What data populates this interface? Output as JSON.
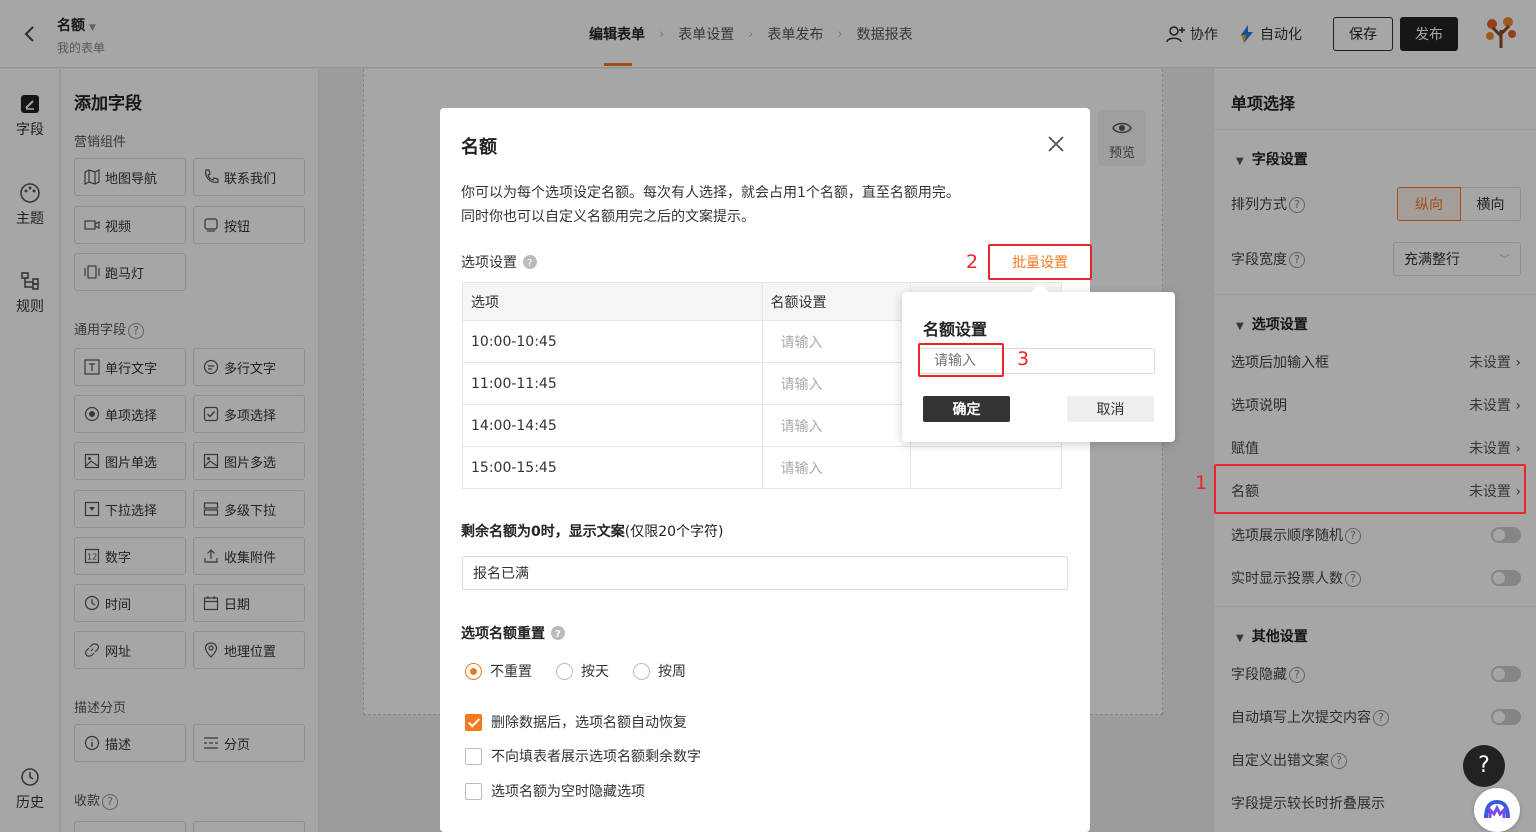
{
  "header": {
    "title": "名额",
    "subtitle": "我的表单",
    "steps": [
      "编辑表单",
      "表单设置",
      "表单发布",
      "数据报表"
    ],
    "collab_label": "协作",
    "automation_label": "自动化",
    "save_label": "保存",
    "publish_label": "发布"
  },
  "rail": {
    "items": [
      "字段",
      "主题",
      "规则"
    ],
    "history_label": "历史"
  },
  "field_panel": {
    "title": "添加字段",
    "groups": [
      "营销组件",
      "通用字段",
      "描述分页",
      "收款"
    ],
    "marketing": [
      "地图导航",
      "联系我们",
      "视频",
      "按钮",
      "跑马灯"
    ],
    "general": [
      "单行文字",
      "多行文字",
      "单项选择",
      "多项选择",
      "图片单选",
      "图片多选",
      "下拉选择",
      "多级下拉",
      "数字",
      "收集附件",
      "时间",
      "日期",
      "网址",
      "地理位置"
    ],
    "describe": [
      "描述",
      "分页"
    ]
  },
  "preview_label": "预览",
  "right_panel": {
    "title": "单项选择",
    "field_settings": "字段设置",
    "arrange_label": "排列方式",
    "arrange_vertical": "纵向",
    "arrange_horizontal": "横向",
    "width_label": "字段宽度",
    "width_value": "充满整行",
    "option_settings": "选项设置",
    "rows": [
      {
        "label": "选项后加输入框",
        "value": "未设置"
      },
      {
        "label": "选项说明",
        "value": "未设置"
      },
      {
        "label": "赋值",
        "value": "未设置"
      },
      {
        "label": "名额",
        "value": "未设置"
      }
    ],
    "random_label": "选项展示顺序随机",
    "realtime_label": "实时显示投票人数",
    "other_settings": "其他设置",
    "hide_label": "字段隐藏",
    "autofill_label": "自动填写上次提交内容",
    "custom_error_label": "自定义出错文案",
    "collapse_label": "字段提示较长时折叠展示"
  },
  "modal": {
    "title": "名额",
    "desc_line1": "你可以为每个选项设定名额。每次有人选择，就会占用1个名额，直至名额用完。",
    "desc_line2": "同时你也可以自定义名额用完之后的文案提示。",
    "option_settings_label": "选项设置",
    "batch_label": "批量设置",
    "table_headers": [
      "选项",
      "名额设置"
    ],
    "table_rows": [
      "10:00-10:45",
      "11:00-11:45",
      "14:00-14:45",
      "15:00-15:45"
    ],
    "input_placeholder": "请输入",
    "zero_label_bold": "剩余名额为0时，显示文案",
    "zero_label_note": "(仅限20个字符)",
    "zero_value": "报名已满",
    "reset_label": "选项名额重置",
    "reset_options": [
      "不重置",
      "按天",
      "按周"
    ],
    "reset_selected": "不重置",
    "checkboxes": [
      {
        "label": "删除数据后，选项名额自动恢复",
        "checked": true
      },
      {
        "label": "不向填表者展示选项名额剩余数字",
        "checked": false
      },
      {
        "label": "选项名额为空时隐藏选项",
        "checked": false
      }
    ]
  },
  "popover": {
    "title": "名额设置",
    "placeholder": "请输入",
    "ok_label": "确定",
    "cancel_label": "取消"
  },
  "annotations": [
    "1",
    "2",
    "3"
  ],
  "help_label": "?",
  "colors": {
    "accent": "#f47a20",
    "annotation_red": "#e8262b",
    "dark_button": "#222222"
  }
}
